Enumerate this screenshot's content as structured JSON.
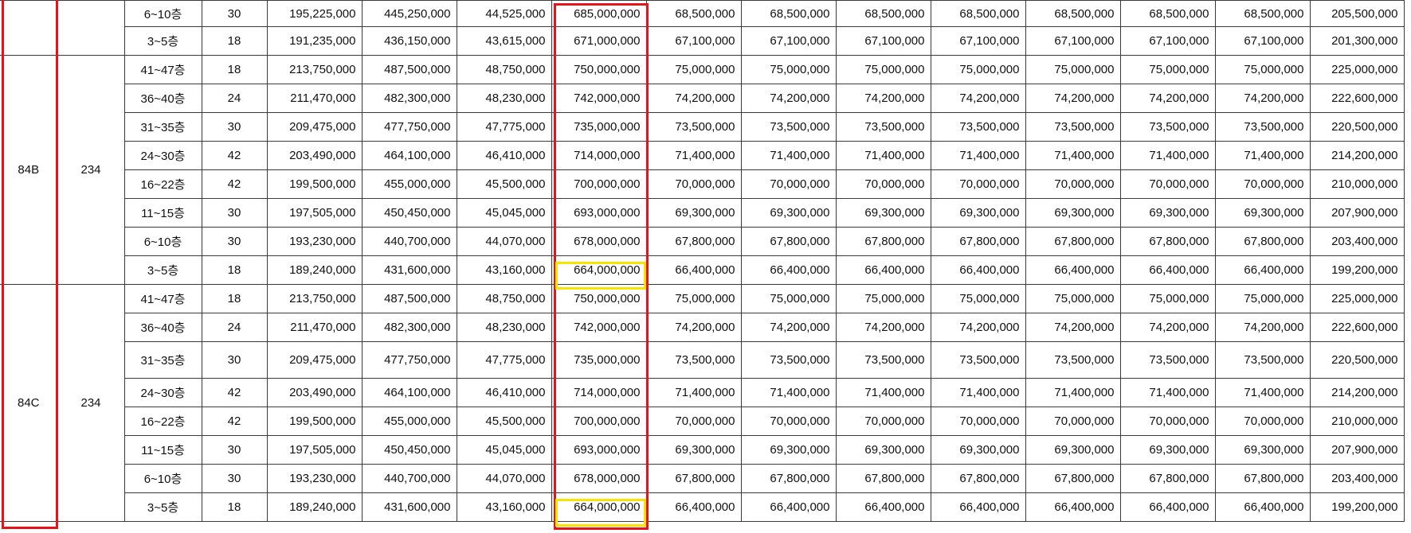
{
  "groups": [
    {
      "type": "",
      "units": "",
      "rows": [
        {
          "floor": "6~10층",
          "count": "30",
          "c1": "195,225,000",
          "c2": "445,250,000",
          "c3": "44,525,000",
          "total": "685,000,000",
          "i1": "68,500,000",
          "i2": "68,500,000",
          "i3": "68,500,000",
          "i4": "68,500,000",
          "i5": "68,500,000",
          "i6": "68,500,000",
          "i7": "68,500,000",
          "bal": "205,500,000"
        },
        {
          "floor": "3~5층",
          "count": "18",
          "c1": "191,235,000",
          "c2": "436,150,000",
          "c3": "43,615,000",
          "total": "671,000,000",
          "i1": "67,100,000",
          "i2": "67,100,000",
          "i3": "67,100,000",
          "i4": "67,100,000",
          "i5": "67,100,000",
          "i6": "67,100,000",
          "i7": "67,100,000",
          "bal": "201,300,000"
        }
      ]
    },
    {
      "type": "84B",
      "units": "234",
      "rows": [
        {
          "floor": "41~47층",
          "count": "18",
          "c1": "213,750,000",
          "c2": "487,500,000",
          "c3": "48,750,000",
          "total": "750,000,000",
          "i1": "75,000,000",
          "i2": "75,000,000",
          "i3": "75,000,000",
          "i4": "75,000,000",
          "i5": "75,000,000",
          "i6": "75,000,000",
          "i7": "75,000,000",
          "bal": "225,000,000"
        },
        {
          "floor": "36~40층",
          "count": "24",
          "c1": "211,470,000",
          "c2": "482,300,000",
          "c3": "48,230,000",
          "total": "742,000,000",
          "i1": "74,200,000",
          "i2": "74,200,000",
          "i3": "74,200,000",
          "i4": "74,200,000",
          "i5": "74,200,000",
          "i6": "74,200,000",
          "i7": "74,200,000",
          "bal": "222,600,000"
        },
        {
          "floor": "31~35층",
          "count": "30",
          "c1": "209,475,000",
          "c2": "477,750,000",
          "c3": "47,775,000",
          "total": "735,000,000",
          "i1": "73,500,000",
          "i2": "73,500,000",
          "i3": "73,500,000",
          "i4": "73,500,000",
          "i5": "73,500,000",
          "i6": "73,500,000",
          "i7": "73,500,000",
          "bal": "220,500,000"
        },
        {
          "floor": "24~30층",
          "count": "42",
          "c1": "203,490,000",
          "c2": "464,100,000",
          "c3": "46,410,000",
          "total": "714,000,000",
          "i1": "71,400,000",
          "i2": "71,400,000",
          "i3": "71,400,000",
          "i4": "71,400,000",
          "i5": "71,400,000",
          "i6": "71,400,000",
          "i7": "71,400,000",
          "bal": "214,200,000"
        },
        {
          "floor": "16~22층",
          "count": "42",
          "c1": "199,500,000",
          "c2": "455,000,000",
          "c3": "45,500,000",
          "total": "700,000,000",
          "i1": "70,000,000",
          "i2": "70,000,000",
          "i3": "70,000,000",
          "i4": "70,000,000",
          "i5": "70,000,000",
          "i6": "70,000,000",
          "i7": "70,000,000",
          "bal": "210,000,000"
        },
        {
          "floor": "11~15층",
          "count": "30",
          "c1": "197,505,000",
          "c2": "450,450,000",
          "c3": "45,045,000",
          "total": "693,000,000",
          "i1": "69,300,000",
          "i2": "69,300,000",
          "i3": "69,300,000",
          "i4": "69,300,000",
          "i5": "69,300,000",
          "i6": "69,300,000",
          "i7": "69,300,000",
          "bal": "207,900,000"
        },
        {
          "floor": "6~10층",
          "count": "30",
          "c1": "193,230,000",
          "c2": "440,700,000",
          "c3": "44,070,000",
          "total": "678,000,000",
          "i1": "67,800,000",
          "i2": "67,800,000",
          "i3": "67,800,000",
          "i4": "67,800,000",
          "i5": "67,800,000",
          "i6": "67,800,000",
          "i7": "67,800,000",
          "bal": "203,400,000"
        },
        {
          "floor": "3~5층",
          "count": "18",
          "c1": "189,240,000",
          "c2": "431,600,000",
          "c3": "43,160,000",
          "total": "664,000,000",
          "i1": "66,400,000",
          "i2": "66,400,000",
          "i3": "66,400,000",
          "i4": "66,400,000",
          "i5": "66,400,000",
          "i6": "66,400,000",
          "i7": "66,400,000",
          "bal": "199,200,000"
        }
      ]
    },
    {
      "type": "84C",
      "units": "234",
      "rows": [
        {
          "floor": "41~47층",
          "count": "18",
          "c1": "213,750,000",
          "c2": "487,500,000",
          "c3": "48,750,000",
          "total": "750,000,000",
          "i1": "75,000,000",
          "i2": "75,000,000",
          "i3": "75,000,000",
          "i4": "75,000,000",
          "i5": "75,000,000",
          "i6": "75,000,000",
          "i7": "75,000,000",
          "bal": "225,000,000"
        },
        {
          "floor": "36~40층",
          "count": "24",
          "c1": "211,470,000",
          "c2": "482,300,000",
          "c3": "48,230,000",
          "total": "742,000,000",
          "i1": "74,200,000",
          "i2": "74,200,000",
          "i3": "74,200,000",
          "i4": "74,200,000",
          "i5": "74,200,000",
          "i6": "74,200,000",
          "i7": "74,200,000",
          "bal": "222,600,000"
        },
        {
          "floor": "31~35층",
          "count": "30",
          "c1": "209,475,000",
          "c2": "477,750,000",
          "c3": "47,775,000",
          "total": "735,000,000",
          "i1": "73,500,000",
          "i2": "73,500,000",
          "i3": "73,500,000",
          "i4": "73,500,000",
          "i5": "73,500,000",
          "i6": "73,500,000",
          "i7": "73,500,000",
          "bal": "220,500,000"
        },
        {
          "floor": "24~30층",
          "count": "42",
          "c1": "203,490,000",
          "c2": "464,100,000",
          "c3": "46,410,000",
          "total": "714,000,000",
          "i1": "71,400,000",
          "i2": "71,400,000",
          "i3": "71,400,000",
          "i4": "71,400,000",
          "i5": "71,400,000",
          "i6": "71,400,000",
          "i7": "71,400,000",
          "bal": "214,200,000"
        },
        {
          "floor": "16~22층",
          "count": "42",
          "c1": "199,500,000",
          "c2": "455,000,000",
          "c3": "45,500,000",
          "total": "700,000,000",
          "i1": "70,000,000",
          "i2": "70,000,000",
          "i3": "70,000,000",
          "i4": "70,000,000",
          "i5": "70,000,000",
          "i6": "70,000,000",
          "i7": "70,000,000",
          "bal": "210,000,000"
        },
        {
          "floor": "11~15층",
          "count": "30",
          "c1": "197,505,000",
          "c2": "450,450,000",
          "c3": "45,045,000",
          "total": "693,000,000",
          "i1": "69,300,000",
          "i2": "69,300,000",
          "i3": "69,300,000",
          "i4": "69,300,000",
          "i5": "69,300,000",
          "i6": "69,300,000",
          "i7": "69,300,000",
          "bal": "207,900,000"
        },
        {
          "floor": "6~10층",
          "count": "30",
          "c1": "193,230,000",
          "c2": "440,700,000",
          "c3": "44,070,000",
          "total": "678,000,000",
          "i1": "67,800,000",
          "i2": "67,800,000",
          "i3": "67,800,000",
          "i4": "67,800,000",
          "i5": "67,800,000",
          "i6": "67,800,000",
          "i7": "67,800,000",
          "bal": "203,400,000"
        },
        {
          "floor": "3~5층",
          "count": "18",
          "c1": "189,240,000",
          "c2": "431,600,000",
          "c3": "43,160,000",
          "total": "664,000,000",
          "i1": "66,400,000",
          "i2": "66,400,000",
          "i3": "66,400,000",
          "i4": "66,400,000",
          "i5": "66,400,000",
          "i6": "66,400,000",
          "i7": "66,400,000",
          "bal": "199,200,000"
        }
      ]
    }
  ],
  "highlight_colors": {
    "column_box": "#e8131a",
    "min_price_box": "#f5e500"
  }
}
